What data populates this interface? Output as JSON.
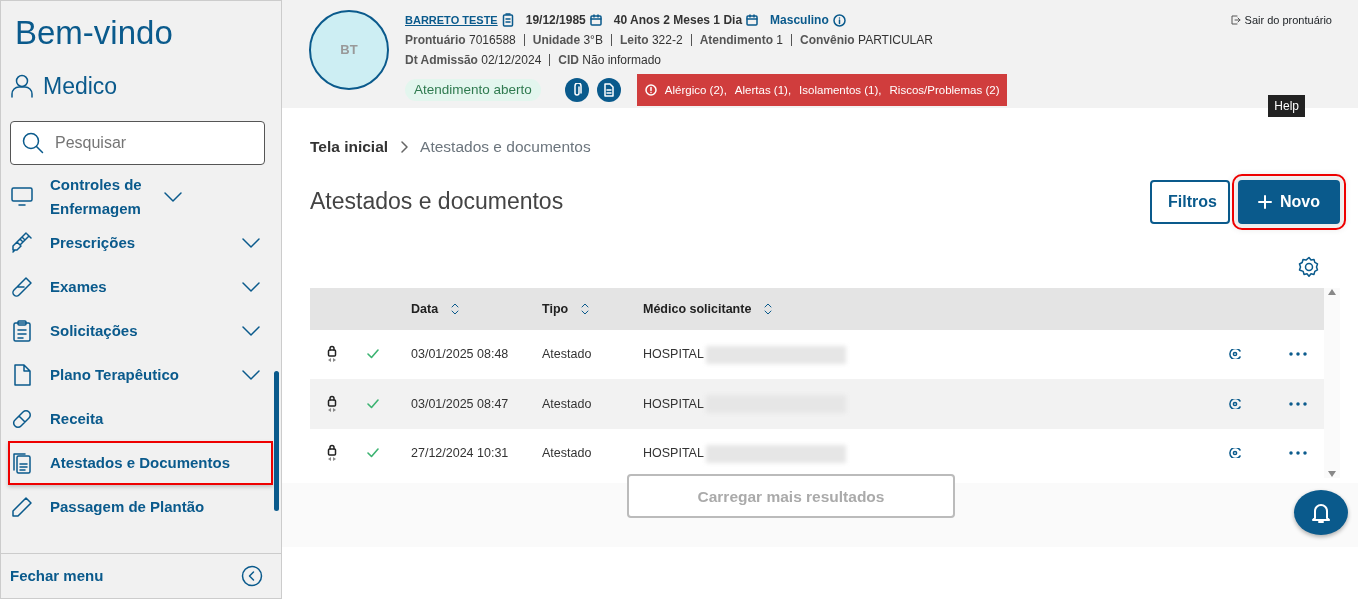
{
  "sidebar": {
    "title": "Bem-vindo",
    "user": "Medico",
    "search": {
      "placeholder": "Pesquisar"
    },
    "items": [
      {
        "label": "Controles de Enfermagem",
        "expandable": true,
        "highlighted": false
      },
      {
        "label": "Prescrições",
        "expandable": true,
        "highlighted": false
      },
      {
        "label": "Exames",
        "expandable": true,
        "highlighted": false
      },
      {
        "label": "Solicitações",
        "expandable": true,
        "highlighted": false
      },
      {
        "label": "Plano Terapêutico",
        "expandable": true,
        "highlighted": false
      },
      {
        "label": "Receita",
        "expandable": false,
        "highlighted": false
      },
      {
        "label": "Atestados e Documentos",
        "expandable": false,
        "highlighted": true
      },
      {
        "label": "Passagem de Plantão",
        "expandable": false,
        "highlighted": false
      }
    ],
    "footer": "Fechar menu"
  },
  "patient": {
    "initials": "BT",
    "name": "BARRETO TESTE",
    "birth": "19/12/1985",
    "age": "40 Anos 2 Meses 1 Dia",
    "sex": "Masculino",
    "fields": [
      {
        "label": "Prontuário",
        "value": "7016588"
      },
      {
        "label": "Unidade",
        "value": "3°B"
      },
      {
        "label": "Leito",
        "value": "322-2"
      },
      {
        "label": "Atendimento",
        "value": "1"
      },
      {
        "label": "Convênio",
        "value": "PARTICULAR"
      }
    ],
    "fields2": [
      {
        "label": "Dt Admissão",
        "value": "02/12/2024"
      },
      {
        "label": "CID",
        "value": "Não informado"
      }
    ],
    "status": "Atendimento aberto",
    "alerts": [
      "Alérgico (2),",
      "Alertas (1),",
      "Isolamentos (1),",
      "Riscos/Problemas (2)"
    ],
    "exit": "Sair do prontuário"
  },
  "tooltip": "Help",
  "breadcrumb": [
    {
      "label": "Tela inicial",
      "link": true
    },
    {
      "label": "Atestados e documentos",
      "link": false
    }
  ],
  "page_title": "Atestados e documentos",
  "buttons": [
    {
      "label": "Filtros",
      "kind": "outline",
      "highlighted": false
    },
    {
      "label": "Novo",
      "kind": "primary",
      "highlighted": true
    }
  ],
  "table": {
    "columns": [
      "Data",
      "Tipo",
      "Médico solicitante"
    ],
    "rows": [
      {
        "date": "03/01/2025 08:48",
        "type": "Atestado",
        "doctor": "HOSPITAL",
        "signed": true
      },
      {
        "date": "03/01/2025 08:47",
        "type": "Atestado",
        "doctor": "HOSPITAL",
        "signed": true
      },
      {
        "date": "27/12/2024 10:31",
        "type": "Atestado",
        "doctor": "HOSPITAL",
        "signed": true
      }
    ]
  },
  "load_more": {
    "label": "Carregar mais resultados",
    "disabled": true
  }
}
